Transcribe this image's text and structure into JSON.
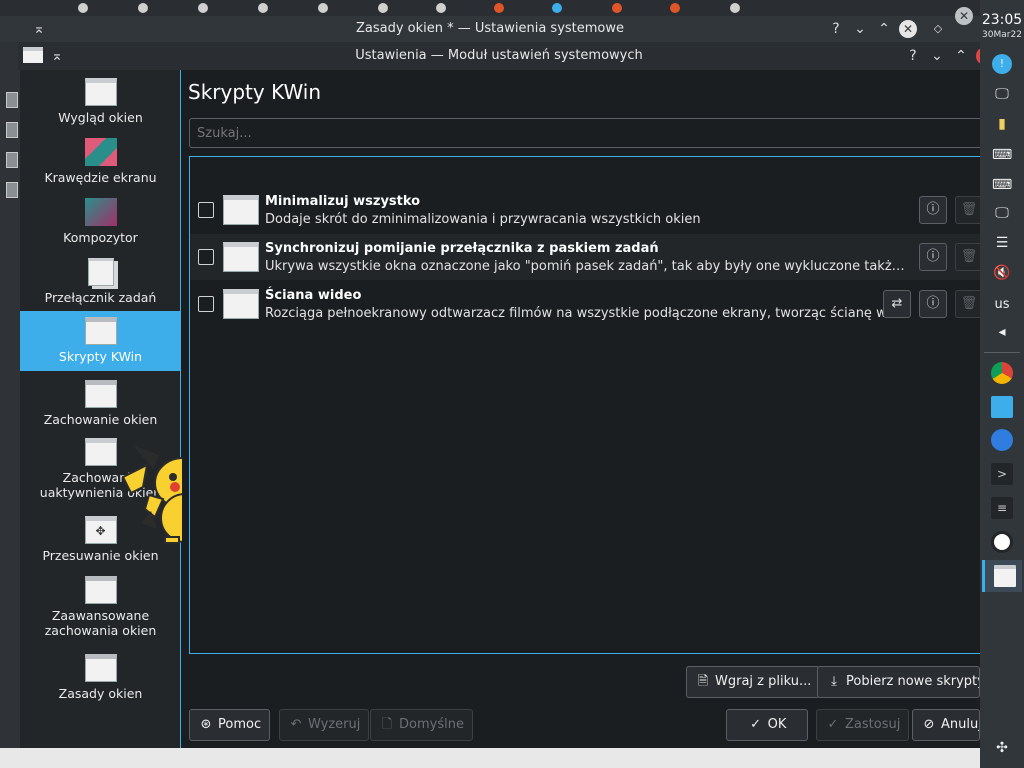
{
  "outer_window": {
    "title": "Zasady okien * — Ustawienia systemowe",
    "help": "?",
    "minimize": "⌄",
    "maximize": "⌃",
    "close": "✕"
  },
  "inner_window": {
    "title": "Ustawienia — Moduł ustawień systemowych",
    "help": "?",
    "minimize": "⌄",
    "maximize": "⌃"
  },
  "sidebar": {
    "items": [
      {
        "label": "Wygląd okien"
      },
      {
        "label": "Krawędzie ekranu"
      },
      {
        "label": "Kompozytor"
      },
      {
        "label": "Przełącznik zadań"
      },
      {
        "label": "Skrypty KWin"
      },
      {
        "label": "Zachowanie okien"
      },
      {
        "label": "Zachowanie uaktywnienia okien"
      },
      {
        "label": "Przesuwanie okien"
      },
      {
        "label": "Zaawansowane zachowania okien"
      },
      {
        "label": "Zasady okien"
      }
    ]
  },
  "main": {
    "title": "Skrypty KWin",
    "search_placeholder": "Szukaj...",
    "scripts": [
      {
        "name": "Minimalizuj wszystko",
        "description": "Dodaje skrót do zminimalizowania i przywracania wszystkich okien"
      },
      {
        "name": "Synchronizuj pomijanie przełącznika z paskiem zadań",
        "description": "Ukrywa wszystkie okna oznaczone jako \"pomiń pasek zadań\", tak aby były one wykluczone także z układ..."
      },
      {
        "name": "Ściana wideo",
        "description": "Rozciąga pełnoekranowy odtwarzacz filmów na wszystkie podłączone ekrany, tworząc ścianę wideo"
      }
    ],
    "install_button": "Wgraj z pliku...",
    "get_new_button": "Pobierz nowe skrypty..."
  },
  "footer": {
    "help": "Pomoc",
    "reset": "Wyzeruj",
    "defaults": "Domyślne",
    "ok": "OK",
    "apply": "Zastosuj",
    "cancel": "Anuluj"
  },
  "panel": {
    "time": "23:05",
    "date": "30Mar22",
    "keyboard_layout": "us"
  },
  "colors": {
    "accent": "#3daee9",
    "background": "#1b1e20",
    "sidebar": "#232629"
  }
}
